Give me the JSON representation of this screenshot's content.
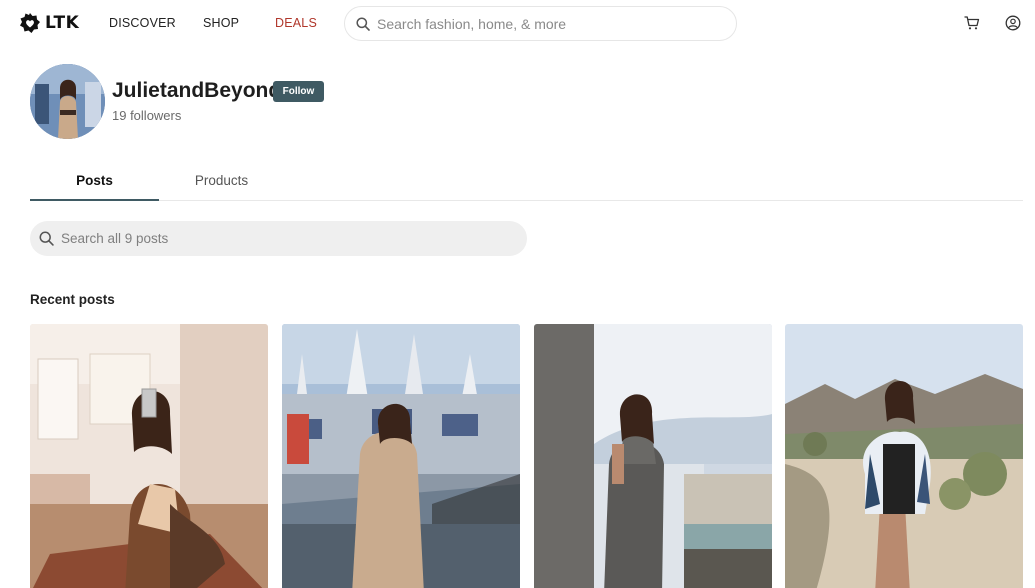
{
  "header": {
    "brand": "LTK",
    "nav": [
      {
        "label": "DISCOVER"
      },
      {
        "label": "SHOP"
      },
      {
        "label": "DEALS"
      }
    ],
    "search_placeholder": "Search fashion, home, & more",
    "icons": [
      "search-icon",
      "cart-icon",
      "account-icon"
    ],
    "accent_deals": "#b0372b"
  },
  "profile": {
    "name": "JulietandBeyond",
    "follow_label": "Follow",
    "followers": "19 followers",
    "follow_color": "#3f5a63"
  },
  "tabs": [
    {
      "label": "Posts",
      "active": true
    },
    {
      "label": "Products",
      "active": false
    }
  ],
  "post_search": {
    "placeholder": "Search all 9 posts"
  },
  "recent": {
    "title": "Recent posts",
    "posts": [
      {
        "alt": "Mirror selfie in patterned dress"
      },
      {
        "alt": "Sweater dress at castle"
      },
      {
        "alt": "Gray knit dress by window"
      },
      {
        "alt": "Desert outfit with kimono"
      }
    ]
  }
}
